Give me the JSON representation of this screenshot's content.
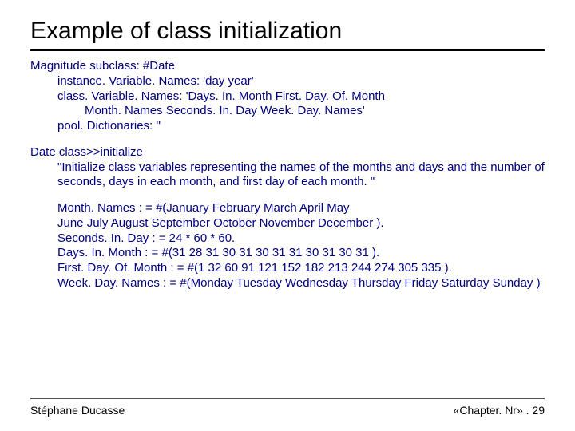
{
  "title": "Example of class initialization",
  "block1": {
    "l1": "Magnitude subclass: #Date",
    "l2": "instance. Variable. Names:  'day year'",
    "l3": "class. Variable. Names:  'Days. In. Month  First. Day. Of. Month",
    "l4": "Month. Names  Seconds. In. Day  Week. Day. Names'",
    "l5": "pool. Dictionaries:  ''"
  },
  "block2": {
    "l1": "Date class>>initialize",
    "l2": "\"Initialize class variables representing the names of the months and days and the number of seconds, days in each month, and first day of each month. \""
  },
  "block3": {
    "l1": "Month. Names : = #(January February March April May",
    "l2": "June July August September October November December ).",
    "l3": "Seconds. In. Day : = 24 * 60 * 60.",
    "l4": "Days. In. Month : = #(31 28 31 30 31 30 31 31 30 31 30 31 ).",
    "l5": "First. Day. Of. Month : = #(1 32 60 91 121 152 182 213 244 274 305 335 ).",
    "l6": "Week. Day. Names : = #(Monday Tuesday Wednesday Thursday Friday Saturday Sunday )"
  },
  "footer": {
    "left": "Stéphane Ducasse",
    "right": "«Chapter. Nr» . 29"
  }
}
